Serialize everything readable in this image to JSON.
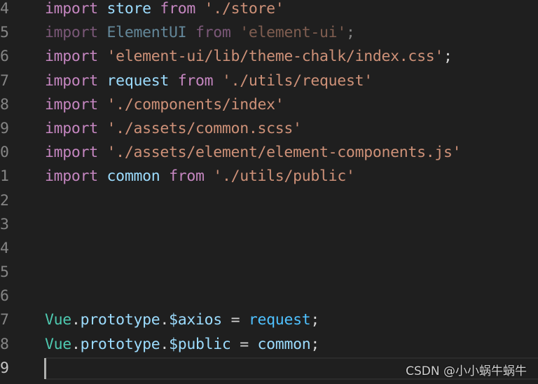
{
  "editor": {
    "lines": [
      {
        "number": "4",
        "tokens": [
          {
            "t": "import",
            "c": "kw"
          },
          {
            "t": " ",
            "c": "punc"
          },
          {
            "t": "store",
            "c": "var"
          },
          {
            "t": " ",
            "c": "punc"
          },
          {
            "t": "from",
            "c": "kw"
          },
          {
            "t": " ",
            "c": "punc"
          },
          {
            "t": "'./store'",
            "c": "str"
          }
        ]
      },
      {
        "number": "5",
        "dim": true,
        "tokens": [
          {
            "t": "import",
            "c": "kw"
          },
          {
            "t": " ",
            "c": "punc"
          },
          {
            "t": "ElementUI",
            "c": "var"
          },
          {
            "t": " ",
            "c": "punc"
          },
          {
            "t": "from",
            "c": "kw"
          },
          {
            "t": " ",
            "c": "punc"
          },
          {
            "t": "'element-ui'",
            "c": "str"
          },
          {
            "t": ";",
            "c": "punc"
          }
        ]
      },
      {
        "number": "6",
        "tokens": [
          {
            "t": "import",
            "c": "kw"
          },
          {
            "t": " ",
            "c": "punc"
          },
          {
            "t": "'element-ui/lib/theme-chalk/index.css'",
            "c": "str"
          },
          {
            "t": ";",
            "c": "punc"
          }
        ]
      },
      {
        "number": "7",
        "tokens": [
          {
            "t": "import",
            "c": "kw"
          },
          {
            "t": " ",
            "c": "punc"
          },
          {
            "t": "request",
            "c": "var"
          },
          {
            "t": " ",
            "c": "punc"
          },
          {
            "t": "from",
            "c": "kw"
          },
          {
            "t": " ",
            "c": "punc"
          },
          {
            "t": "'./utils/request'",
            "c": "str"
          }
        ]
      },
      {
        "number": "8",
        "tokens": [
          {
            "t": "import",
            "c": "kw"
          },
          {
            "t": " ",
            "c": "punc"
          },
          {
            "t": "'./components/index'",
            "c": "str"
          }
        ]
      },
      {
        "number": "9",
        "tokens": [
          {
            "t": "import",
            "c": "kw"
          },
          {
            "t": " ",
            "c": "punc"
          },
          {
            "t": "'./assets/common.scss'",
            "c": "str"
          }
        ]
      },
      {
        "number": "0",
        "tokens": [
          {
            "t": "import",
            "c": "kw"
          },
          {
            "t": " ",
            "c": "punc"
          },
          {
            "t": "'./assets/element/element-components.js'",
            "c": "str"
          }
        ]
      },
      {
        "number": "1",
        "tokens": [
          {
            "t": "import",
            "c": "kw"
          },
          {
            "t": " ",
            "c": "punc"
          },
          {
            "t": "common",
            "c": "var"
          },
          {
            "t": " ",
            "c": "punc"
          },
          {
            "t": "from",
            "c": "kw"
          },
          {
            "t": " ",
            "c": "punc"
          },
          {
            "t": "'./utils/public'",
            "c": "str"
          }
        ]
      },
      {
        "number": "2",
        "tokens": []
      },
      {
        "number": "3",
        "tokens": []
      },
      {
        "number": "4",
        "tokens": []
      },
      {
        "number": "5",
        "tokens": []
      },
      {
        "number": "6",
        "tokens": []
      },
      {
        "number": "7",
        "tokens": [
          {
            "t": "Vue",
            "c": "cls"
          },
          {
            "t": ".",
            "c": "punc"
          },
          {
            "t": "prototype",
            "c": "var"
          },
          {
            "t": ".",
            "c": "punc"
          },
          {
            "t": "$axios",
            "c": "var"
          },
          {
            "t": " = ",
            "c": "punc"
          },
          {
            "t": "request",
            "c": "fn"
          },
          {
            "t": ";",
            "c": "punc"
          }
        ]
      },
      {
        "number": "8",
        "tokens": [
          {
            "t": "Vue",
            "c": "cls"
          },
          {
            "t": ".",
            "c": "punc"
          },
          {
            "t": "prototype",
            "c": "var"
          },
          {
            "t": ".",
            "c": "punc"
          },
          {
            "t": "$public",
            "c": "var"
          },
          {
            "t": " = ",
            "c": "punc"
          },
          {
            "t": "common",
            "c": "var"
          },
          {
            "t": ";",
            "c": "punc"
          }
        ]
      },
      {
        "number": "9",
        "active": true,
        "tokens": []
      }
    ]
  },
  "watermark": "CSDN @小小蜗牛蜗牛"
}
